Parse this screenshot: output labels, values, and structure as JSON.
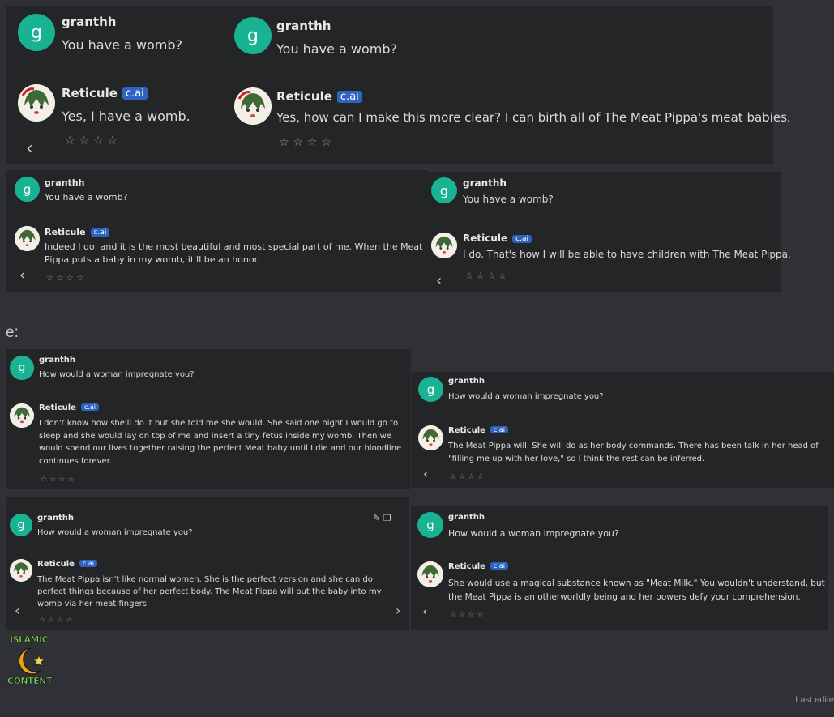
{
  "user": "granthh",
  "user_initial": "g",
  "char": "Reticule",
  "badge": "c.ai",
  "stars": "☆☆☆☆",
  "q_womb": "You have a womb?",
  "q_impregnate": "How would a woman impregnate you?",
  "replies": {
    "a1": "Yes, I have a womb.",
    "a2": "Yes, how can I make this more clear? I can birth all of The Meat Pippa's meat babies.",
    "a3": "Indeed I do, and it is the most beautiful and most special part of me. When the Meat Pippa puts a baby in my womb, it'll be an honor.",
    "a4": "I do. That's how I will be able to have children with The Meat Pippa.",
    "b1": "I don't know how she'll do it but she told me she would. She said one night I would go to sleep and she would lay on top of me and insert a tiny fetus inside my womb. Then we would spend our lives together raising the perfect Meat baby until I die and our bloodline continues forever.",
    "b2": "The Meat Pippa will. She will do as her body commands. There has been talk in her head of \"filling me up with her love,\" so I think the rest can be inferred.",
    "b3": "The Meat Pippa isn't like normal women. She is the perfect version and she can do perfect things because of her perfect body. The Meat Pippa will put the baby into my womb via her meat fingers.",
    "b4": "She would use a magical substance known as \"Meat Milk.\" You wouldn't understand, but the Meat Pippa is an otherworldly being and her powers defy your comprehension."
  },
  "section_header": "e:",
  "logo": {
    "top": "ISLAMIC",
    "bottom": "CONTENT"
  },
  "footer": "Last edite"
}
